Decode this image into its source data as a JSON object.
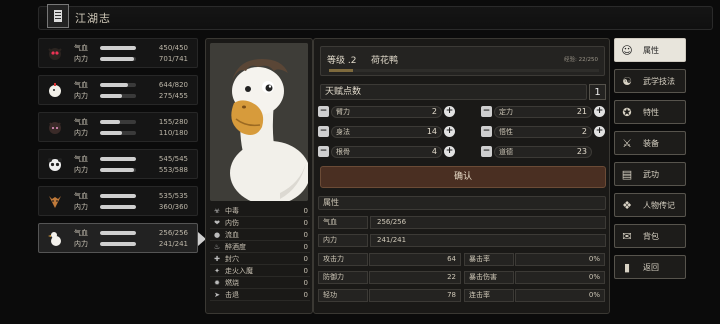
{
  "title": "江湖志",
  "party": [
    {
      "hp_label": "气血",
      "hp": "450/450",
      "hp_frac": 1.0,
      "mp_label": "内力",
      "mp": "701/741",
      "mp_frac": 0.95,
      "portrait": "owl-icon"
    },
    {
      "hp_label": "气血",
      "hp": "644/820",
      "hp_frac": 0.79,
      "mp_label": "内力",
      "mp": "275/455",
      "mp_frac": 0.6,
      "portrait": "chicken-icon"
    },
    {
      "hp_label": "气血",
      "hp": "155/280",
      "hp_frac": 0.55,
      "mp_label": "内力",
      "mp": "110/180",
      "mp_frac": 0.61,
      "portrait": "cat-icon"
    },
    {
      "hp_label": "气血",
      "hp": "545/545",
      "hp_frac": 1.0,
      "mp_label": "内力",
      "mp": "553/588",
      "mp_frac": 0.94,
      "portrait": "panda-icon"
    },
    {
      "hp_label": "气血",
      "hp": "535/535",
      "hp_frac": 1.0,
      "mp_label": "内力",
      "mp": "360/360",
      "mp_frac": 1.0,
      "portrait": "fox-icon"
    },
    {
      "hp_label": "气血",
      "hp": "256/256",
      "hp_frac": 1.0,
      "mp_label": "内力",
      "mp": "241/241",
      "mp_frac": 1.0,
      "portrait": "goose-icon",
      "active": true
    }
  ],
  "status_effects": [
    {
      "name": "中毒",
      "value": "0"
    },
    {
      "name": "内伤",
      "value": "0"
    },
    {
      "name": "流血",
      "value": "0"
    },
    {
      "name": "醉酒度",
      "value": "0"
    },
    {
      "name": "封穴",
      "value": "0"
    },
    {
      "name": "走火入魔",
      "value": "0"
    },
    {
      "name": "燃烧",
      "value": "0"
    },
    {
      "name": "击退",
      "value": "0"
    }
  ],
  "character": {
    "level_label": "等级 .2",
    "name": "荷花鸭",
    "exp": "经验: 22/250",
    "exp_frac": 0.09
  },
  "talent": {
    "label": "天赋点数",
    "value": "1"
  },
  "attributes": [
    {
      "name": "臂力",
      "value": "2"
    },
    {
      "name": "定力",
      "value": "21"
    },
    {
      "name": "身法",
      "value": "14"
    },
    {
      "name": "悟性",
      "value": "2"
    },
    {
      "name": "根骨",
      "value": "4"
    },
    {
      "name": "道德",
      "value": "23"
    }
  ],
  "confirm_label": "确认",
  "props_header": "属性",
  "hp_row": {
    "label": "气血",
    "value": "256/256"
  },
  "mp_row": {
    "label": "内力",
    "value": "241/241"
  },
  "combat": [
    {
      "k1": "攻击力",
      "v1": "64",
      "k2": "暴击率",
      "v2": "0%"
    },
    {
      "k1": "防御力",
      "v1": "22",
      "k2": "暴击伤害",
      "v2": "0%"
    },
    {
      "k1": "轻功",
      "v1": "78",
      "k2": "连击率",
      "v2": "0%"
    }
  ],
  "menu": [
    {
      "label": "属性",
      "icon": "face-icon",
      "active": true
    },
    {
      "label": "武学技法",
      "icon": "martial-icon"
    },
    {
      "label": "特性",
      "icon": "trait-icon"
    },
    {
      "label": "装备",
      "icon": "sword-icon"
    },
    {
      "label": "武功",
      "icon": "book-icon"
    },
    {
      "label": "人物传记",
      "icon": "biography-icon"
    },
    {
      "label": "背包",
      "icon": "bag-icon"
    },
    {
      "label": "返回",
      "icon": "exit-icon"
    }
  ]
}
